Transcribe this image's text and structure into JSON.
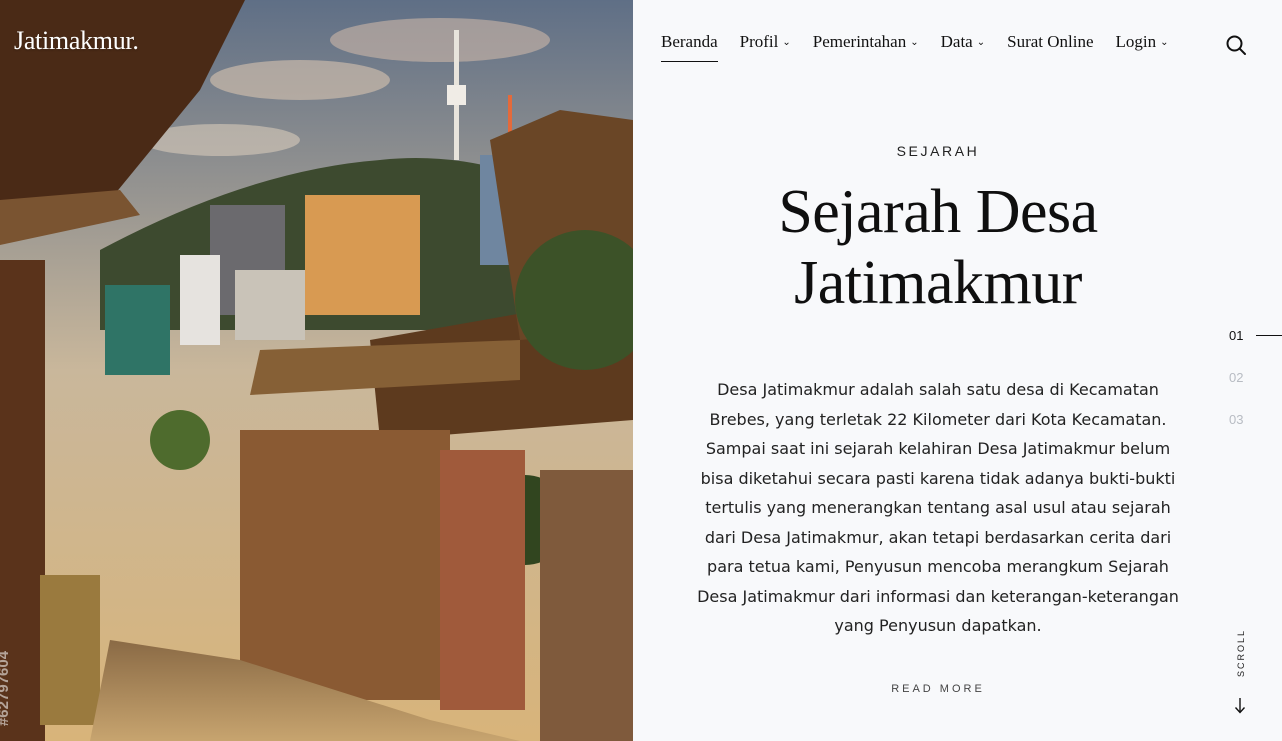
{
  "site": {
    "logo": "Jatimakmur.",
    "image_watermark": "#62797604"
  },
  "nav": {
    "items": [
      {
        "label": "Beranda",
        "dropdown": false,
        "active": true
      },
      {
        "label": "Profil",
        "dropdown": true
      },
      {
        "label": "Pemerintahan",
        "dropdown": true
      },
      {
        "label": "Data",
        "dropdown": true
      },
      {
        "label": "Surat Online",
        "dropdown": false
      },
      {
        "label": "Login",
        "dropdown": true
      }
    ],
    "chevron": "⌄",
    "search_icon": "search-icon"
  },
  "hero": {
    "eyebrow": "SEJARAH",
    "title_line1": "Sejarah Desa",
    "title_line2": "Jatimakmur",
    "body": "Desa Jatimakmur adalah salah satu desa di Kecamatan Brebes, yang terletak 22 Kilometer dari Kota Kecamatan. Sampai saat ini sejarah kelahiran Desa Jatimakmur belum bisa diketahui secara pasti karena tidak adanya bukti-bukti tertulis yang menerangkan tentang asal usul atau sejarah dari Desa Jatimakmur, akan tetapi berdasarkan cerita dari para tetua kami, Penyusun mencoba merangkum Sejarah Desa Jatimakmur dari informasi dan keterangan-keterangan yang Penyusun dapatkan.",
    "read_more": "READ MORE"
  },
  "slides": {
    "items": [
      "01",
      "02",
      "03"
    ],
    "active": "01"
  },
  "scroll": {
    "label": "SCROLL",
    "icon": "arrow-down-icon"
  },
  "colors": {
    "background": "#f8f9fb",
    "text": "#111111",
    "muted": "#b8bcc3"
  }
}
